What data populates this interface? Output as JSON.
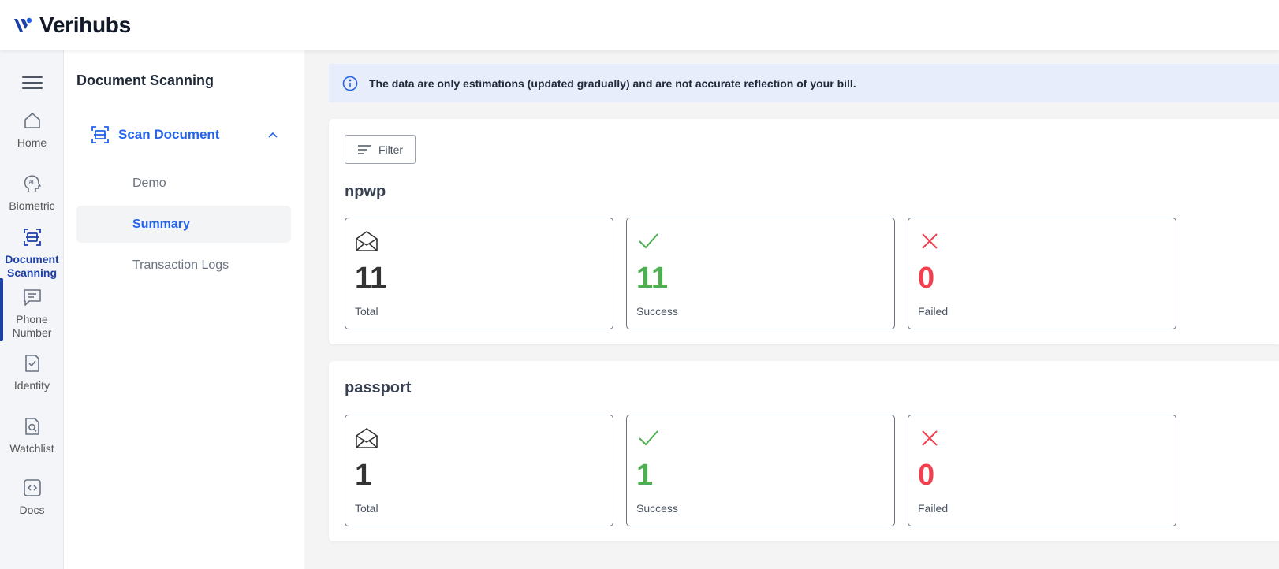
{
  "app": {
    "name": "Verihubs"
  },
  "rail": {
    "items": [
      {
        "label": "Home",
        "icon": "home-icon"
      },
      {
        "label": "Biometric",
        "icon": "ai-face-icon"
      },
      {
        "label": "Document Scanning",
        "icon": "scan-document-icon",
        "active": true
      },
      {
        "label": "Phone Number",
        "icon": "chat-icon"
      },
      {
        "label": "Identity",
        "icon": "check-document-icon"
      },
      {
        "label": "Watchlist",
        "icon": "search-document-icon"
      },
      {
        "label": "Docs",
        "icon": "code-icon"
      }
    ]
  },
  "subnav": {
    "title": "Document Scanning",
    "group": {
      "label": "Scan Document",
      "expanded": true
    },
    "links": [
      {
        "label": "Demo"
      },
      {
        "label": "Summary",
        "active": true
      },
      {
        "label": "Transaction Logs"
      }
    ]
  },
  "banner": {
    "text": "The data are only estimations (updated gradually) and are not accurate reflection of your bill."
  },
  "filter": {
    "label": "Filter"
  },
  "sections": [
    {
      "title": "npwp",
      "stats": [
        {
          "value": "11",
          "label": "Total"
        },
        {
          "value": "11",
          "label": "Success"
        },
        {
          "value": "0",
          "label": "Failed"
        }
      ]
    },
    {
      "title": "passport",
      "stats": [
        {
          "value": "1",
          "label": "Total"
        },
        {
          "value": "1",
          "label": "Success"
        },
        {
          "value": "0",
          "label": "Failed"
        }
      ]
    }
  ],
  "colors": {
    "brand": "#1d3fa8",
    "accent": "#2563eb",
    "total": "#333333",
    "success": "#4caf50",
    "failed": "#f04050",
    "banner_bg": "#e8edfc"
  }
}
